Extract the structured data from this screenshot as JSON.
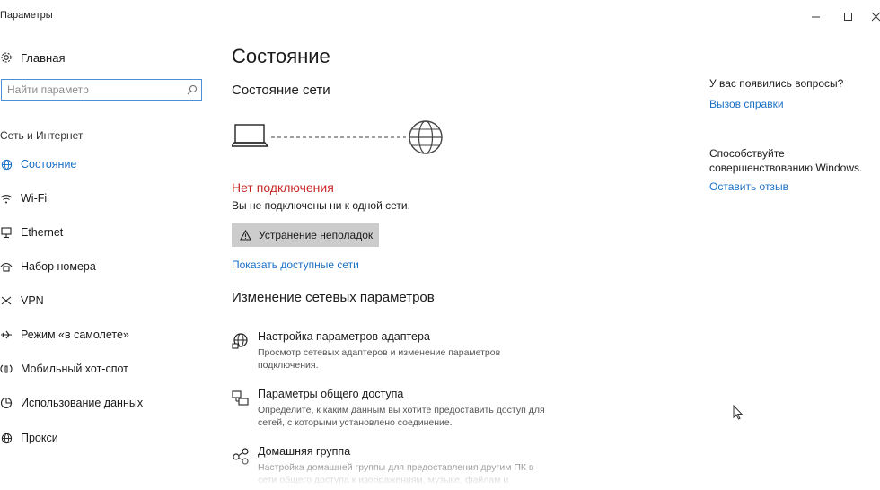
{
  "window": {
    "title": "Параметры",
    "minimize_icon": "minimize-icon",
    "maximize_icon": "maximize-icon",
    "close_icon": "close-icon"
  },
  "sidebar": {
    "home_label": "Главная",
    "home_icon": "gear-icon",
    "search_placeholder": "Найти параметр",
    "search_icon": "search-icon",
    "section_title": "Сеть и Интернет",
    "items": [
      {
        "label": "Состояние",
        "icon": "globe-icon",
        "active": true
      },
      {
        "label": "Wi-Fi",
        "icon": "wifi-icon",
        "active": false
      },
      {
        "label": "Ethernet",
        "icon": "ethernet-icon",
        "active": false
      },
      {
        "label": "Набор номера",
        "icon": "dialup-icon",
        "active": false
      },
      {
        "label": "VPN",
        "icon": "vpn-icon",
        "active": false
      },
      {
        "label": "Режим «в самолете»",
        "icon": "airplane-icon",
        "active": false
      },
      {
        "label": "Мобильный хот-спот",
        "icon": "hotspot-icon",
        "active": false
      },
      {
        "label": "Использование данных",
        "icon": "data-usage-icon",
        "active": false
      },
      {
        "label": "Прокси",
        "icon": "globe-icon",
        "active": false
      }
    ]
  },
  "main": {
    "title": "Состояние",
    "network_status_heading": "Состояние сети",
    "diagram": {
      "left_icon": "laptop-icon",
      "right_icon": "globe-icon"
    },
    "status_error": "Нет подключения",
    "status_desc": "Вы не подключены ни к одной сети.",
    "troubleshoot_label": "Устранение неполадок",
    "troubleshoot_icon": "warning-icon",
    "show_networks_link": "Показать доступные сети",
    "change_heading": "Изменение сетевых параметров",
    "options": [
      {
        "title": "Настройка параметров адаптера",
        "desc": "Просмотр сетевых адаптеров и изменение параметров подключения.",
        "icon": "adapter-icon"
      },
      {
        "title": "Параметры общего доступа",
        "desc": "Определите, к каким данным вы хотите предоставить доступ для сетей, с которыми установлено соединение.",
        "icon": "sharing-icon"
      },
      {
        "title": "Домашняя группа",
        "desc": "Настройка домашней группы для предоставления другим ПК в сети общего доступа к изображениям, музыке, файлам и",
        "icon": "homegroup-icon"
      }
    ]
  },
  "right_panel": {
    "question": "У вас появились вопросы?",
    "help_link": "Вызов справки",
    "improve_text": "Способствуйте совершенствованию Windows.",
    "feedback_link": "Оставить отзыв"
  },
  "colors": {
    "accent": "#1a6fc4",
    "error": "#c62828",
    "button_bg": "#cccccc",
    "search_border": "#4a8fd8"
  }
}
